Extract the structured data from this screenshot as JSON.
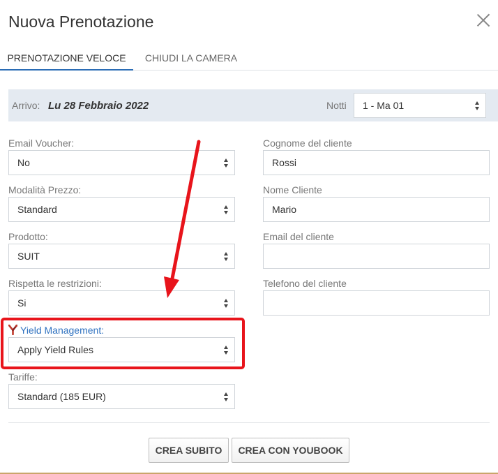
{
  "modal": {
    "title": "Nuova Prenotazione"
  },
  "tabs": [
    {
      "label": "PRENOTAZIONE VELOCE"
    },
    {
      "label": "CHIUDI LA CAMERA"
    }
  ],
  "arrival": {
    "label": "Arrivo:",
    "date": "Lu 28 Febbraio 2022",
    "nights_label": "Notti",
    "nights_value": "1 - Ma 01"
  },
  "left_fields": {
    "email_voucher": {
      "label": "Email Voucher:",
      "value": "No"
    },
    "modalita_prezzo": {
      "label": "Modalità Prezzo:",
      "value": "Standard"
    },
    "prodotto": {
      "label": "Prodotto:",
      "value": "SUIT"
    },
    "restrizioni": {
      "label": "Rispetta le restrizioni:",
      "value": "Si"
    },
    "yield": {
      "label": "Yield Management:",
      "value": "Apply Yield Rules"
    },
    "tariffe": {
      "label": "Tariffe:",
      "value": "Standard (185 EUR)"
    }
  },
  "right_fields": {
    "cognome": {
      "label": "Cognome del cliente",
      "value": "Rossi"
    },
    "nome": {
      "label": "Nome Cliente",
      "value": "Mario"
    },
    "email": {
      "label": "Email del cliente",
      "value": ""
    },
    "telefono": {
      "label": "Telefono del cliente",
      "value": ""
    }
  },
  "buttons": {
    "crea_subito": "CREA SUBITO",
    "crea_youbook": "CREA CON YOUBOOK"
  },
  "colors": {
    "accent": "#2a6cb5",
    "highlight": "#e8141b",
    "arrival_bg": "#e4eaf1"
  },
  "icons": {
    "close": "close-icon",
    "yield": "yield-icon",
    "select_arrows": "select-arrows-icon"
  }
}
